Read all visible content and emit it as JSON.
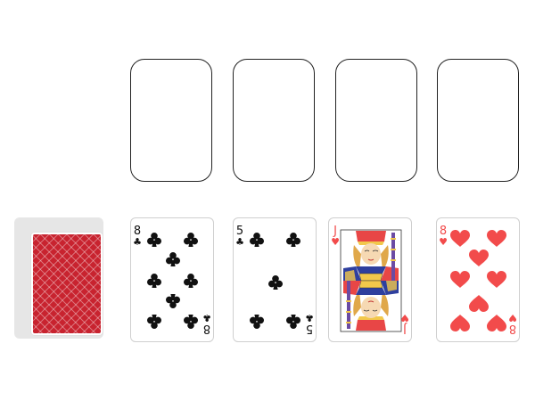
{
  "foundations": [
    {
      "id": "foundation-1",
      "empty": true
    },
    {
      "id": "foundation-2",
      "empty": true
    },
    {
      "id": "foundation-3",
      "empty": true
    },
    {
      "id": "foundation-4",
      "empty": true
    }
  ],
  "stock": {
    "face": "down",
    "back_color": "#c8232f"
  },
  "tableau": [
    {
      "rank": "8",
      "suit": "♣",
      "suit_name": "clubs",
      "color": "black"
    },
    {
      "rank": "5",
      "suit": "♣",
      "suit_name": "clubs",
      "color": "black"
    },
    {
      "rank": "J",
      "suit": "♥",
      "suit_name": "hearts",
      "color": "red"
    },
    {
      "rank": "8",
      "suit": "♥",
      "suit_name": "hearts",
      "color": "red"
    }
  ],
  "colors": {
    "black": "#111111",
    "red": "#f24b4b",
    "back": "#c8232f"
  }
}
